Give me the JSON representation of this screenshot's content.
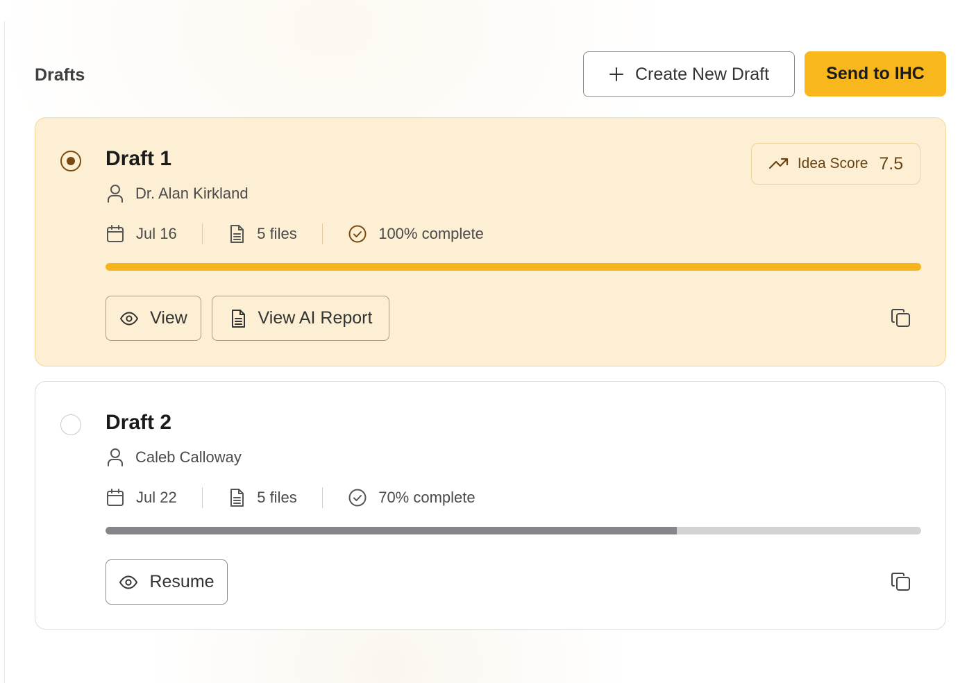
{
  "header": {
    "title": "Drafts",
    "create_button": "Create New Draft",
    "send_button": "Send to IHC"
  },
  "drafts": [
    {
      "title": "Draft 1",
      "author": "Dr. Alan Kirkland",
      "date": "Jul 16",
      "files": "5 files",
      "completion_label": "100% complete",
      "completion": 1.0,
      "selected": true,
      "idea_score_label": "Idea Score",
      "idea_score": "7.5",
      "actions": [
        "View",
        "View AI Report"
      ]
    },
    {
      "title": "Draft 2",
      "author": "Caleb Calloway",
      "date": "Jul 22",
      "files": "5 files",
      "completion_label": "70% complete",
      "completion": 0.7,
      "selected": false,
      "actions": [
        "Resume"
      ]
    }
  ],
  "colors": {
    "accent": "#f8b71c",
    "selected_card_bg": "#fcefd4",
    "score_text": "#6b4310",
    "progress_incomplete": "#85858b"
  },
  "icons": {
    "create": "plus-icon",
    "author": "user-icon",
    "date": "calendar-icon",
    "files": "document-icon",
    "complete": "check-circle-icon",
    "score": "trending-up-icon",
    "view": "eye-icon",
    "report": "document-icon",
    "copy": "copy-icon"
  }
}
